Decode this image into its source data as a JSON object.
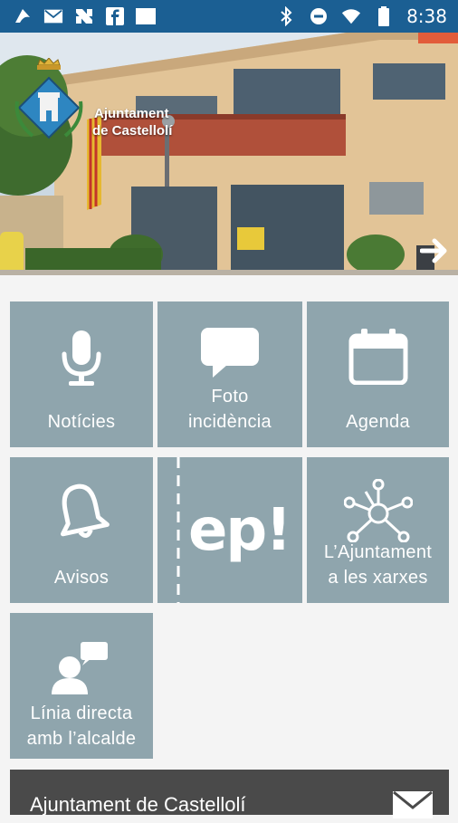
{
  "status_bar": {
    "time": "8:38",
    "left_icons": [
      "app-icon",
      "mail-icon",
      "news-icon",
      "facebook-icon",
      "square-icon"
    ],
    "right_icons": [
      "bluetooth-icon",
      "do-not-disturb-icon",
      "wifi-icon",
      "battery-icon"
    ]
  },
  "hero": {
    "logo_line1": "Ajuntament",
    "logo_line2": "de Castellolí",
    "next_icon": "arrow-right-icon"
  },
  "tiles": [
    {
      "label_line1": "Notícies",
      "label_line2": "",
      "icon": "microphone-icon"
    },
    {
      "label_line1": "Foto",
      "label_line2": "incidència",
      "icon": "speech-bubble-icon"
    },
    {
      "label_line1": "Agenda",
      "label_line2": "",
      "icon": "calendar-icon"
    },
    {
      "label_line1": "Avisos",
      "label_line2": "",
      "icon": "bell-icon"
    },
    {
      "label_line1": "ep!",
      "label_line2": "",
      "icon": "ep-logo"
    },
    {
      "label_line1": "L’Ajuntament",
      "label_line2": "a les xarxes",
      "icon": "network-icon"
    },
    {
      "label_line1": "Línia directa",
      "label_line2": "amb l’alcalde",
      "icon": "chat-user-icon"
    }
  ],
  "footer": {
    "title": "Ajuntament de Castellolí",
    "icon": "envelope-icon"
  },
  "colors": {
    "status_bar": "#1b5f93",
    "tile": "#8fa5ad",
    "footer": "#4a4a4a"
  }
}
